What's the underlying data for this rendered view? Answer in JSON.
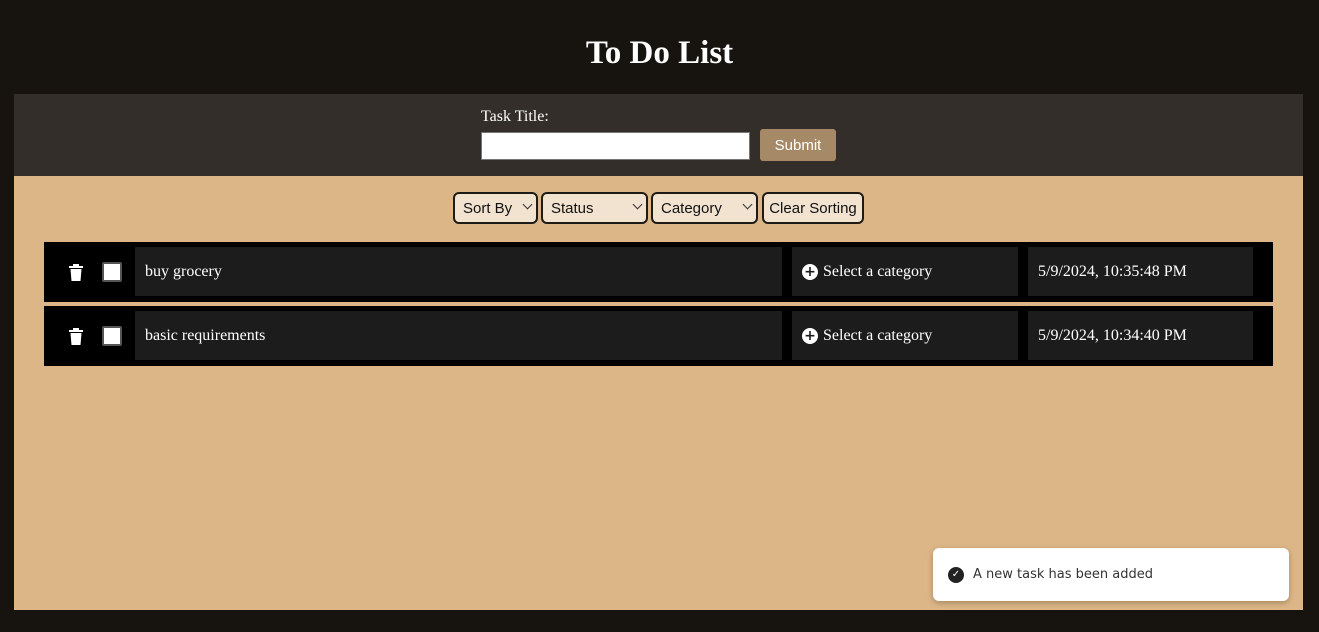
{
  "app": {
    "title": "To Do List"
  },
  "form": {
    "label": "Task Title:",
    "input_value": "",
    "input_placeholder": "",
    "submit_label": "Submit"
  },
  "sort_bar": {
    "sort_by": "Sort By",
    "status": "Status",
    "category": "Category",
    "clear": "Clear Sorting"
  },
  "tasks": [
    {
      "text": "buy grocery",
      "category": "Select a category",
      "date": "5/9/2024, 10:35:48 PM",
      "completed": false
    },
    {
      "text": "basic requirements",
      "category": "Select a category",
      "date": "5/9/2024, 10:34:40 PM",
      "completed": false
    }
  ],
  "toast": {
    "message": "A new task has been added"
  },
  "colors": {
    "page_bg": "#171410",
    "form_panel": "#332e29",
    "main_bg": "#dcb686",
    "submit_btn": "#a68a68",
    "row_bg": "#000000",
    "cell_bg": "#1c1c1c"
  },
  "icons": {
    "delete": "trash-icon",
    "add_category": "plus-circle-icon",
    "toast": "check-circle-icon"
  }
}
